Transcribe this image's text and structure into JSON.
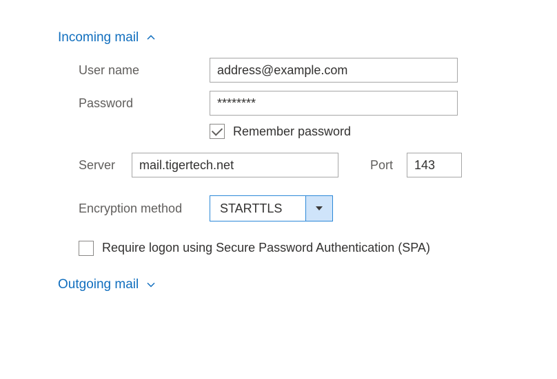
{
  "sections": {
    "incoming": {
      "title": "Incoming mail",
      "expanded": true
    },
    "outgoing": {
      "title": "Outgoing mail",
      "expanded": false
    }
  },
  "labels": {
    "username": "User name",
    "password": "Password",
    "remember": "Remember password",
    "server": "Server",
    "port": "Port",
    "encryption": "Encryption method",
    "spa": "Require logon using Secure Password Authentication (SPA)"
  },
  "values": {
    "username": "address@example.com",
    "password": "********",
    "server": "mail.tigertech.net",
    "port": "143",
    "encryption": "STARTTLS",
    "remember_checked": true,
    "spa_checked": false
  }
}
